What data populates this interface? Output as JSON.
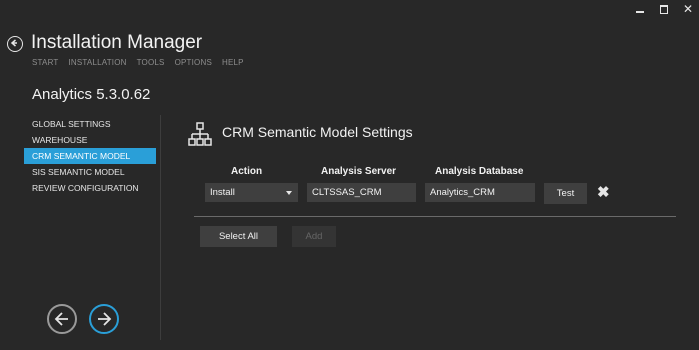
{
  "window": {
    "controls": {
      "minimize_icon": "minimize-icon",
      "maximize_icon": "maximize-icon",
      "close_icon": "close-icon",
      "close_glyph": "✕"
    }
  },
  "header": {
    "title": "Installation Manager",
    "back_icon": "back-circle-icon",
    "menu": [
      "START",
      "INSTALLATION",
      "TOOLS",
      "OPTIONS",
      "HELP"
    ],
    "product": "Analytics 5.3.0.62"
  },
  "sidebar": {
    "items": [
      {
        "label": "GLOBAL SETTINGS",
        "active": false
      },
      {
        "label": "WAREHOUSE",
        "active": false
      },
      {
        "label": "CRM SEMANTIC MODEL",
        "active": true
      },
      {
        "label": "SIS SEMANTIC MODEL",
        "active": false
      },
      {
        "label": "REVIEW CONFIGURATION",
        "active": false
      }
    ],
    "active_color": "#2a9fd8"
  },
  "content": {
    "title": "CRM Semantic Model Settings",
    "title_icon": "hierarchy-icon",
    "columns": {
      "action": "Action",
      "server": "Analysis Server",
      "database": "Analysis Database"
    },
    "row": {
      "action": "Install",
      "server": "CLTSSAS_CRM",
      "database": "Analytics_CRM",
      "test_label": "Test",
      "remove_icon": "remove-x-icon",
      "remove_glyph": "✖"
    },
    "select_all_label": "Select All",
    "add_label": "Add"
  },
  "footer": {
    "prev_icon": "arrow-left-icon",
    "next_icon": "arrow-right-icon"
  }
}
